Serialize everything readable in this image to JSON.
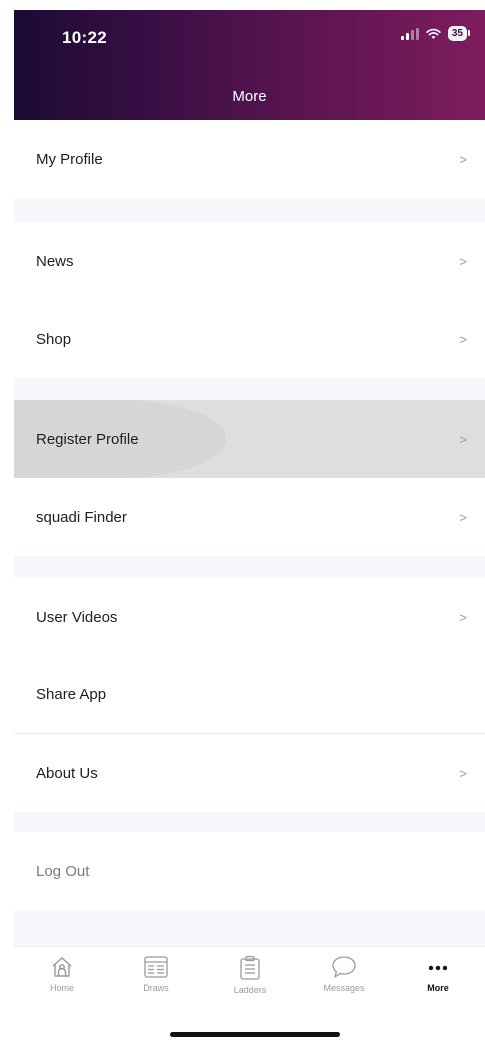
{
  "status_bar": {
    "time": "10:22",
    "battery": "35"
  },
  "header": {
    "title": "More"
  },
  "menu": {
    "chevron": ">",
    "items": [
      {
        "label": "My Profile"
      },
      {
        "label": "News"
      },
      {
        "label": "Shop"
      },
      {
        "label": "Register Profile"
      },
      {
        "label": "squadi Finder"
      },
      {
        "label": "User Videos"
      },
      {
        "label": "Share App"
      },
      {
        "label": "About Us"
      },
      {
        "label": "Log Out"
      }
    ]
  },
  "tabbar": {
    "tabs": [
      {
        "label": "Home",
        "icon": "home-icon"
      },
      {
        "label": "Draws",
        "icon": "draws-icon"
      },
      {
        "label": "Ladders",
        "icon": "ladders-icon"
      },
      {
        "label": "Messages",
        "icon": "messages-icon"
      },
      {
        "label": "More",
        "icon": "more-icon",
        "active": true
      }
    ]
  },
  "colors": {
    "header_gradient_start": "#1c0a35",
    "header_gradient_end": "#7e1c5e",
    "spacer_bg": "#f5f7fb",
    "highlight_bg": "#dedede"
  }
}
